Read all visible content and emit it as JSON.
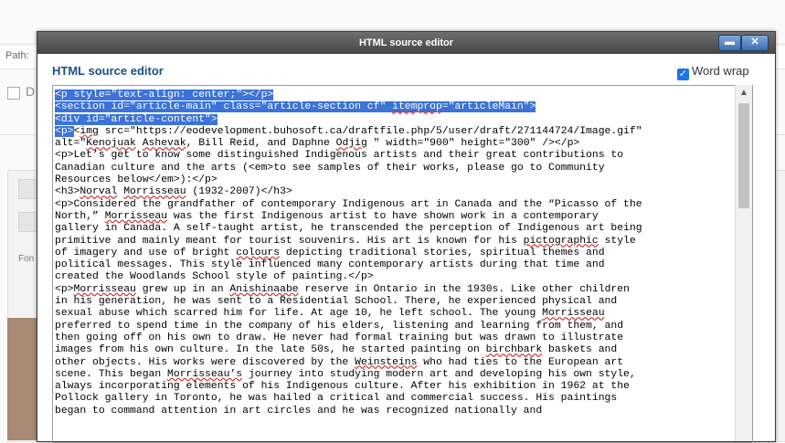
{
  "background": {
    "path_label": "Path:",
    "checkbox_letter": "D",
    "font_label": "Fon"
  },
  "dialog": {
    "title": "HTML source editor",
    "heading": "HTML source editor",
    "word_wrap_label": "Word wrap",
    "word_wrap_checked": true,
    "code_lines": [
      [
        {
          "t": "<p style=\"text-align: center;\"></p>",
          "s": true
        }
      ],
      [
        {
          "t": "<section id=\"article-main\" class=\"article-section cf\" ",
          "s": true
        },
        {
          "t": "itemprop",
          "s": true,
          "w": true
        },
        {
          "t": "=\"articleMain\">",
          "s": true
        }
      ],
      [
        {
          "t": "<div id=\"article-content\">",
          "s": true
        }
      ],
      [
        {
          "t": "<p>",
          "s": true
        },
        {
          "t": "<"
        },
        {
          "t": "img",
          "w": true
        },
        {
          "t": " src=\"https://eodevelopment.buhosoft.ca/draftfile.php/5/user/draft/271144724/Image.gif\""
        }
      ],
      [
        {
          "t": "alt=\""
        },
        {
          "t": "Kenojuak",
          "w": true
        },
        {
          "t": " "
        },
        {
          "t": "Ashevak",
          "w": true
        },
        {
          "t": ", Bill Reid, and Daphne "
        },
        {
          "t": "Odjig",
          "w": true
        },
        {
          "t": " \" width=\"900\" height=\"300\" /></p>"
        }
      ],
      [
        {
          "t": "<p>Let’s get to know some distinguished Indigenous artists and their great contributions to"
        }
      ],
      [
        {
          "t": "Canadian culture and the arts (<em>to see samples of their works, please go to Community"
        }
      ],
      [
        {
          "t": "Resources below</em>):</p>"
        }
      ],
      [
        {
          "t": "<h3>"
        },
        {
          "t": "Norval",
          "w": true
        },
        {
          "t": " "
        },
        {
          "t": "Morrisseau",
          "w": true
        },
        {
          "t": " (1932-2007)</h3>"
        }
      ],
      [
        {
          "t": "<p>Considered the grandfather of contemporary Indigenous art in Canada and the “Picasso of the"
        }
      ],
      [
        {
          "t": "North,” "
        },
        {
          "t": "Morrisseau",
          "w": true
        },
        {
          "t": " was the first Indigenous artist to have shown work in a contemporary"
        }
      ],
      [
        {
          "t": "gallery in Canada. A self-taught artist, he transcended the perception of Indigenous art being"
        }
      ],
      [
        {
          "t": "primitive and mainly meant for tourist souvenirs. His art is known for his "
        },
        {
          "t": "pictographic",
          "w": true
        },
        {
          "t": " style"
        }
      ],
      [
        {
          "t": "of imagery and use of bright "
        },
        {
          "t": "colours",
          "w": true
        },
        {
          "t": " depicting traditional stories, spiritual themes and"
        }
      ],
      [
        {
          "t": "political messages. This style influenced many contemporary artists during that time and"
        }
      ],
      [
        {
          "t": "created the Woodlands School style of painting.</p>"
        }
      ],
      [
        {
          "t": "<p>"
        },
        {
          "t": "Morrisseau",
          "w": true
        },
        {
          "t": " grew up in an "
        },
        {
          "t": "Anishinaabe",
          "w": true
        },
        {
          "t": " reserve in Ontario in the 1930s. Like other children"
        }
      ],
      [
        {
          "t": "in his generation, he was sent to a Residential School. There, he experienced physical and"
        }
      ],
      [
        {
          "t": "sexual abuse which scarred him for life. At age 10, he left school. The young "
        },
        {
          "t": "Morrisseau",
          "w": true
        }
      ],
      [
        {
          "t": "preferred to spend time in the company of his elders, listening and learning from them, and"
        }
      ],
      [
        {
          "t": "then going off on his own to draw. He never had formal training but was drawn to illustrate"
        }
      ],
      [
        {
          "t": "images from his own culture. In the late 50s, he started painting on "
        },
        {
          "t": "birchbark",
          "w": true
        },
        {
          "t": " baskets and"
        }
      ],
      [
        {
          "t": "other objects. His works were discovered by the "
        },
        {
          "t": "Weinsteins",
          "w": true
        },
        {
          "t": " who had ties to the European art"
        }
      ],
      [
        {
          "t": "scene. This began "
        },
        {
          "t": "Morrisseau’s",
          "w": true
        },
        {
          "t": " journey into studying modern art and developing his own style,"
        }
      ],
      [
        {
          "t": "always incorporating elements of his Indigenous culture. After his exhibition in 1962 at the"
        }
      ],
      [
        {
          "t": "Pollock gallery in Toronto, he was hailed a critical and commercial success. His paintings"
        }
      ],
      [
        {
          "t": "began to command attention in art circles and he was recognized nationally and"
        }
      ]
    ]
  }
}
